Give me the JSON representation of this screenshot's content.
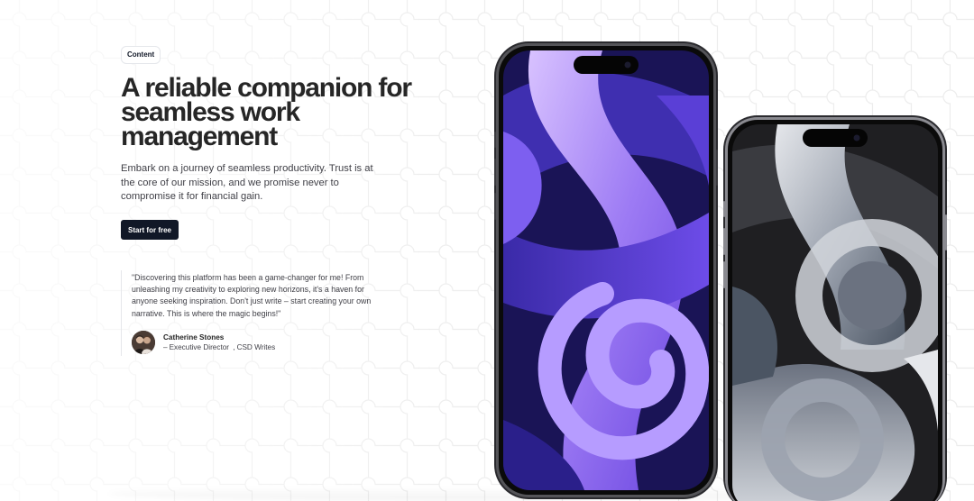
{
  "hero": {
    "badge": "Content",
    "headline": "A reliable companion for seamless work management",
    "lead": "Embark on a journey of seamless productivity. Trust is at the core of our mission, and we promise never to compromise it for financial gain.",
    "cta_label": "Start for free"
  },
  "testimonial": {
    "quote": "\"Discovering this platform has been a game-changer for me! From unleashing my creativity to exploring new horizons, it's a haven for anyone seeking inspiration. Don't just write – start creating your own narrative. This is where the magic begins!\"",
    "author_name": "Catherine Stones",
    "author_dash": "–",
    "author_title": "Executive Director",
    "author_separator": ",",
    "author_company": "CSD Writes"
  },
  "phones": [
    {
      "name": "purple-iphone",
      "wallpaper": "purple-ribbon",
      "accent": "#7c5cf0"
    },
    {
      "name": "silver-iphone",
      "wallpaper": "silver-swirl",
      "accent": "#9ca3af"
    }
  ],
  "colors": {
    "headline": "#262626",
    "body_text": "#3f3f46",
    "button_bg": "#111827",
    "button_text": "#ffffff",
    "background": "#ffffff",
    "pattern_line": "#ececec"
  }
}
